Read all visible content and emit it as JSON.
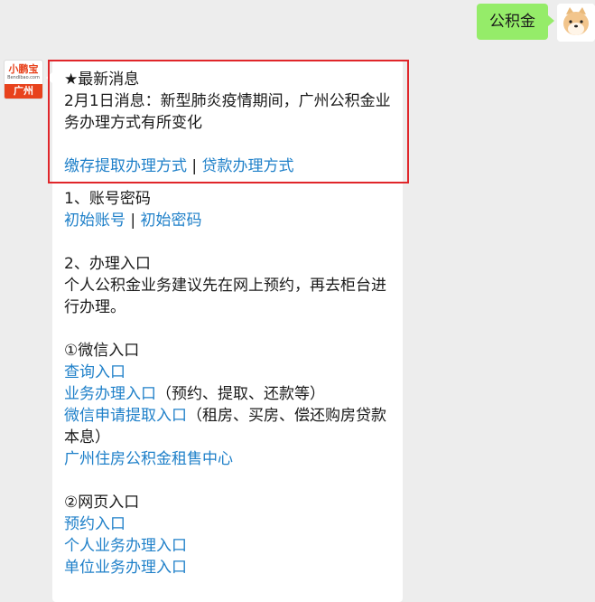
{
  "user_message": "公积金",
  "bot_avatar": {
    "brand": "小鹏宝",
    "domain": "Bendibao.com",
    "city": "广州"
  },
  "news": {
    "heading": "★最新消息",
    "text": "2月1日消息：新型肺炎疫情期间，广州公积金业务办理方式有所变化",
    "link1": "缴存提取办理方式",
    "separator": " | ",
    "link2": "贷款办理方式"
  },
  "section1": {
    "title": "1、账号密码",
    "link1": "初始账号",
    "separator": " | ",
    "link2": "初始密码"
  },
  "section2": {
    "title": "2、办理入口",
    "desc": "个人公积金业务建议先在网上预约，再去柜台进行办理。"
  },
  "wechat": {
    "title": "①微信入口",
    "query_link": "查询入口",
    "business_link": "业务办理入口",
    "business_note": "（预约、提取、还款等）",
    "withdraw_link": "微信申请提取入口",
    "withdraw_note": "（租房、买房、偿还购房贷款本息）",
    "rental_link": "广州住房公积金租售中心"
  },
  "web": {
    "title": "②网页入口",
    "appointment_link": "预约入口",
    "personal_link": "个人业务办理入口",
    "unit_link": "单位业务办理入口"
  }
}
